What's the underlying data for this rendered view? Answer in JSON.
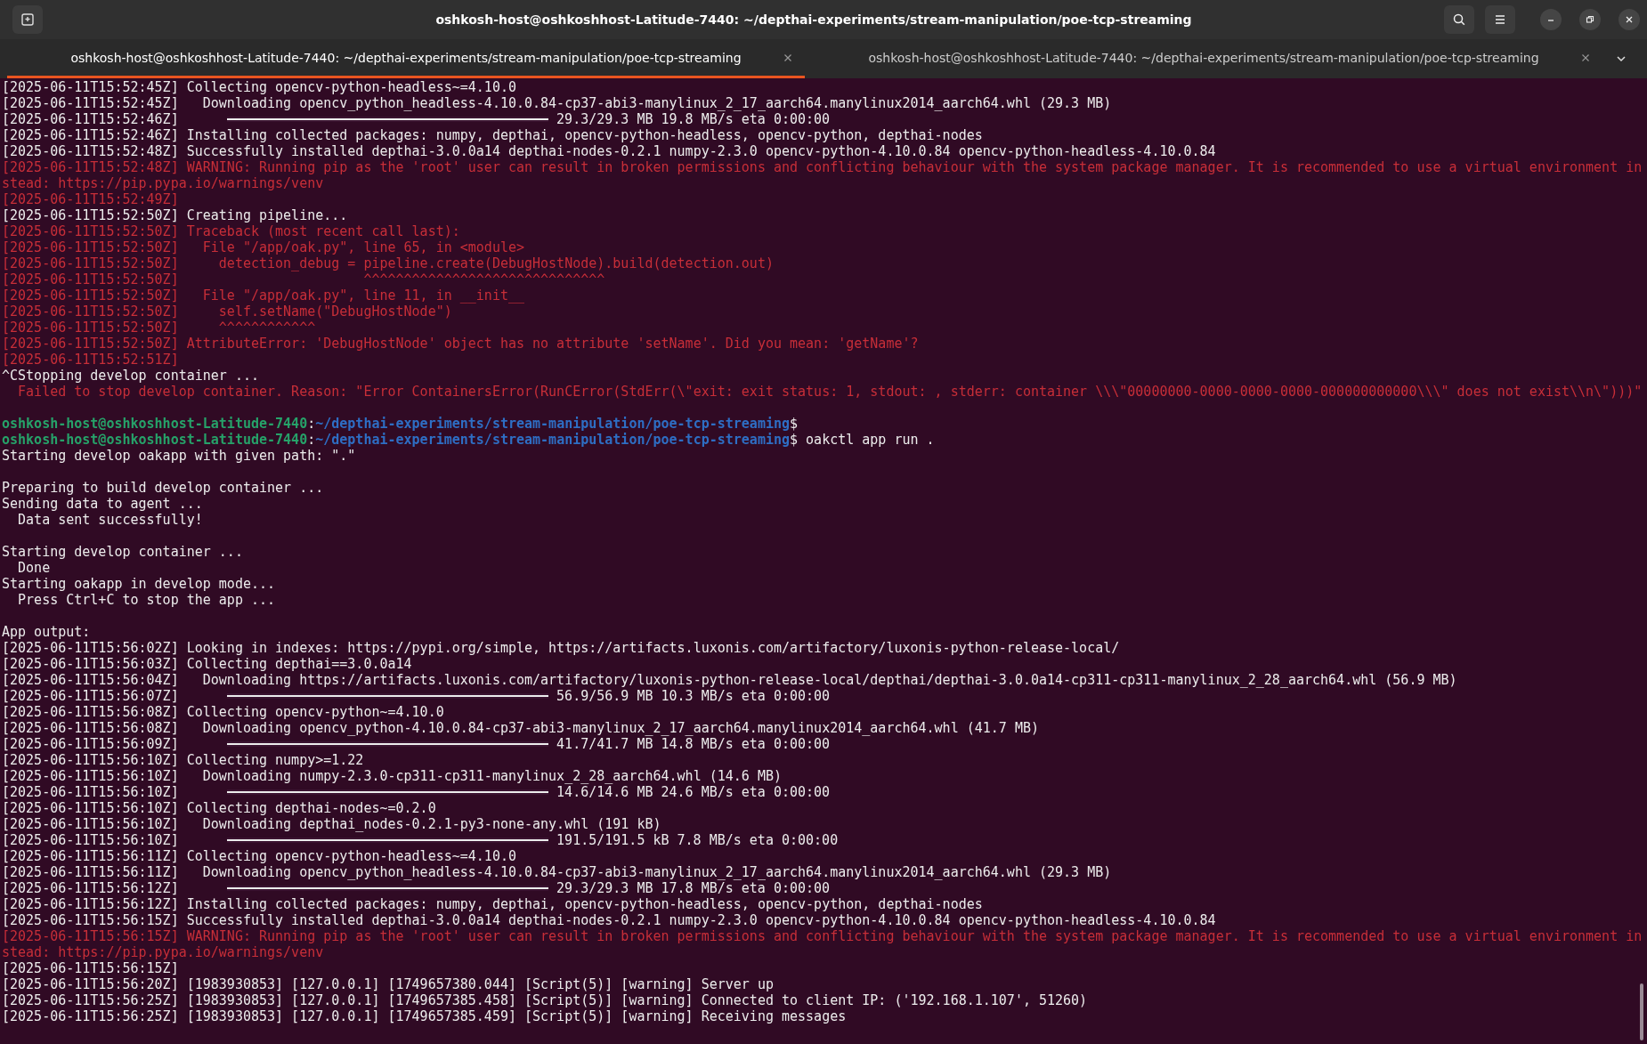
{
  "window": {
    "title": "oshkosh-host@oshkoshhost-Latitude-7440: ~/depthai-experiments/stream-manipulation/poe-tcp-streaming"
  },
  "tabs": [
    {
      "label": "oshkosh-host@oshkoshhost-Latitude-7440: ~/depthai-experiments/stream-manipulation/poe-tcp-streaming",
      "selected": true
    },
    {
      "label": "oshkosh-host@oshkoshhost-Latitude-7440: ~/depthai-experiments/stream-manipulation/poe-tcp-streaming",
      "selected": false
    }
  ],
  "lines": [
    {
      "kind": "text",
      "text": "[2025-06-11T15:52:45Z] Collecting opencv-python-headless~=4.10.0"
    },
    {
      "kind": "text",
      "text": "[2025-06-11T15:52:45Z]   Downloading opencv_python_headless-4.10.0.84-cp37-abi3-manylinux_2_17_aarch64.manylinux2014_aarch64.whl (29.3 MB)"
    },
    {
      "kind": "progress",
      "time": "[2025-06-11T15:52:46Z]",
      "level": 1,
      "reading": "29.3/29.3 MB 19.8 MB/s eta 0:00:00"
    },
    {
      "kind": "text",
      "text": "[2025-06-11T15:52:46Z] Installing collected packages: numpy, depthai, opencv-python-headless, opencv-python, depthai-nodes"
    },
    {
      "kind": "text",
      "text": "[2025-06-11T15:52:48Z] Successfully installed depthai-3.0.0a14 depthai-nodes-0.2.1 numpy-2.3.0 opencv-python-4.10.0.84 opencv-python-headless-4.10.0.84"
    },
    {
      "kind": "error",
      "text": "[2025-06-11T15:52:48Z] WARNING: Running pip as the 'root' user can result in broken permissions and conflicting behaviour with the system package manager. It is recommended to use a virtual environment in"
    },
    {
      "kind": "error",
      "text": "stead: https://pip.pypa.io/warnings/venv"
    },
    {
      "kind": "error",
      "text": "[2025-06-11T15:52:49Z]"
    },
    {
      "kind": "text",
      "text": "[2025-06-11T15:52:50Z] Creating pipeline..."
    },
    {
      "kind": "error",
      "text": "[2025-06-11T15:52:50Z] Traceback (most recent call last):"
    },
    {
      "kind": "error",
      "text": "[2025-06-11T15:52:50Z]   File \"/app/oak.py\", line 65, in <module>"
    },
    {
      "kind": "error",
      "text": "[2025-06-11T15:52:50Z]     detection_debug = pipeline.create(DebugHostNode).build(detection.out)"
    },
    {
      "kind": "error",
      "text": "[2025-06-11T15:52:50Z]                       ^^^^^^^^^^^^^^^^^^^^^^^^^^^^^^"
    },
    {
      "kind": "error",
      "text": "[2025-06-11T15:52:50Z]   File \"/app/oak.py\", line 11, in __init__"
    },
    {
      "kind": "error",
      "text": "[2025-06-11T15:52:50Z]     self.setName(\"DebugHostNode\")"
    },
    {
      "kind": "error",
      "text": "[2025-06-11T15:52:50Z]     ^^^^^^^^^^^^"
    },
    {
      "kind": "error",
      "text": "[2025-06-11T15:52:50Z] AttributeError: 'DebugHostNode' object has no attribute 'setName'. Did you mean: 'getName'?"
    },
    {
      "kind": "error",
      "text": "[2025-06-11T15:52:51Z]"
    },
    {
      "kind": "text",
      "text": "^CStopping develop container ..."
    },
    {
      "kind": "error",
      "text": "  Failed to stop develop container. Reason: \"Error ContainersError(RunCError(StdErr(\\\"exit: exit status: 1, stdout: , stderr: container \\\\\\\"00000000-0000-0000-0000-000000000000\\\\\\\" does not exist\\\\n\\\")))\""
    },
    {
      "kind": "blank"
    },
    {
      "kind": "prompt",
      "user": "oshkosh-host@oshkoshhost-Latitude-7440",
      "separator": ":",
      "path": "~/depthai-experiments/stream-manipulation/poe-tcp-streaming",
      "symbol": "$"
    },
    {
      "kind": "prompt",
      "user": "oshkosh-host@oshkoshhost-Latitude-7440",
      "separator": ":",
      "path": "~/depthai-experiments/stream-manipulation/poe-tcp-streaming",
      "symbol": "$",
      "command": "oakctl app run ."
    },
    {
      "kind": "text",
      "text": "Starting develop oakapp with given path: \".\""
    },
    {
      "kind": "blank"
    },
    {
      "kind": "text",
      "text": "Preparing to build develop container ..."
    },
    {
      "kind": "text",
      "text": "Sending data to agent ..."
    },
    {
      "kind": "text",
      "text": "  Data sent successfully!"
    },
    {
      "kind": "blank"
    },
    {
      "kind": "text",
      "text": "Starting develop container ..."
    },
    {
      "kind": "text",
      "text": "  Done"
    },
    {
      "kind": "text",
      "text": "Starting oakapp in develop mode..."
    },
    {
      "kind": "text",
      "text": "  Press Ctrl+C to stop the app ..."
    },
    {
      "kind": "blank"
    },
    {
      "kind": "text",
      "text": "App output:"
    },
    {
      "kind": "text",
      "text": "[2025-06-11T15:56:02Z] Looking in indexes: https://pypi.org/simple, https://artifacts.luxonis.com/artifactory/luxonis-python-release-local/"
    },
    {
      "kind": "text",
      "text": "[2025-06-11T15:56:03Z] Collecting depthai==3.0.0a14"
    },
    {
      "kind": "text",
      "text": "[2025-06-11T15:56:04Z]   Downloading https://artifacts.luxonis.com/artifactory/luxonis-python-release-local/depthai/depthai-3.0.0a14-cp311-cp311-manylinux_2_28_aarch64.whl (56.9 MB)"
    },
    {
      "kind": "progress",
      "time": "[2025-06-11T15:56:07Z]",
      "level": 1,
      "reading": "56.9/56.9 MB 10.3 MB/s eta 0:00:00"
    },
    {
      "kind": "text",
      "text": "[2025-06-11T15:56:08Z] Collecting opencv-python~=4.10.0"
    },
    {
      "kind": "text",
      "text": "[2025-06-11T15:56:08Z]   Downloading opencv_python-4.10.0.84-cp37-abi3-manylinux_2_17_aarch64.manylinux2014_aarch64.whl (41.7 MB)"
    },
    {
      "kind": "progress",
      "time": "[2025-06-11T15:56:09Z]",
      "level": 1,
      "reading": "41.7/41.7 MB 14.8 MB/s eta 0:00:00"
    },
    {
      "kind": "text",
      "text": "[2025-06-11T15:56:10Z] Collecting numpy>=1.22"
    },
    {
      "kind": "text",
      "text": "[2025-06-11T15:56:10Z]   Downloading numpy-2.3.0-cp311-cp311-manylinux_2_28_aarch64.whl (14.6 MB)"
    },
    {
      "kind": "progress",
      "time": "[2025-06-11T15:56:10Z]",
      "level": 1,
      "reading": "14.6/14.6 MB 24.6 MB/s eta 0:00:00"
    },
    {
      "kind": "text",
      "text": "[2025-06-11T15:56:10Z] Collecting depthai-nodes~=0.2.0"
    },
    {
      "kind": "text",
      "text": "[2025-06-11T15:56:10Z]   Downloading depthai_nodes-0.2.1-py3-none-any.whl (191 kB)"
    },
    {
      "kind": "progress",
      "time": "[2025-06-11T15:56:10Z]",
      "level": 1,
      "reading": "191.5/191.5 kB 7.8 MB/s eta 0:00:00"
    },
    {
      "kind": "text",
      "text": "[2025-06-11T15:56:11Z] Collecting opencv-python-headless~=4.10.0"
    },
    {
      "kind": "text",
      "text": "[2025-06-11T15:56:11Z]   Downloading opencv_python_headless-4.10.0.84-cp37-abi3-manylinux_2_17_aarch64.manylinux2014_aarch64.whl (29.3 MB)"
    },
    {
      "kind": "progress",
      "time": "[2025-06-11T15:56:12Z]",
      "level": 1,
      "reading": "29.3/29.3 MB 17.8 MB/s eta 0:00:00"
    },
    {
      "kind": "text",
      "text": "[2025-06-11T15:56:12Z] Installing collected packages: numpy, depthai, opencv-python-headless, opencv-python, depthai-nodes"
    },
    {
      "kind": "text",
      "text": "[2025-06-11T15:56:15Z] Successfully installed depthai-3.0.0a14 depthai-nodes-0.2.1 numpy-2.3.0 opencv-python-4.10.0.84 opencv-python-headless-4.10.0.84"
    },
    {
      "kind": "error",
      "text": "[2025-06-11T15:56:15Z] WARNING: Running pip as the 'root' user can result in broken permissions and conflicting behaviour with the system package manager. It is recommended to use a virtual environment in"
    },
    {
      "kind": "error",
      "text": "stead: https://pip.pypa.io/warnings/venv"
    },
    {
      "kind": "text",
      "text": "[2025-06-11T15:56:15Z]"
    },
    {
      "kind": "text",
      "text": "[2025-06-11T15:56:20Z] [1983930853] [127.0.0.1] [1749657380.044] [Script(5)] [warning] Server up"
    },
    {
      "kind": "text",
      "text": "[2025-06-11T15:56:25Z] [1983930853] [127.0.0.1] [1749657385.458] [Script(5)] [warning] Connected to client IP: ('192.168.1.107', 51260)"
    },
    {
      "kind": "text",
      "text": "[2025-06-11T15:56:25Z] [1983930853] [127.0.0.1] [1749657385.459] [Script(5)] [warning] Receiving messages"
    }
  ]
}
